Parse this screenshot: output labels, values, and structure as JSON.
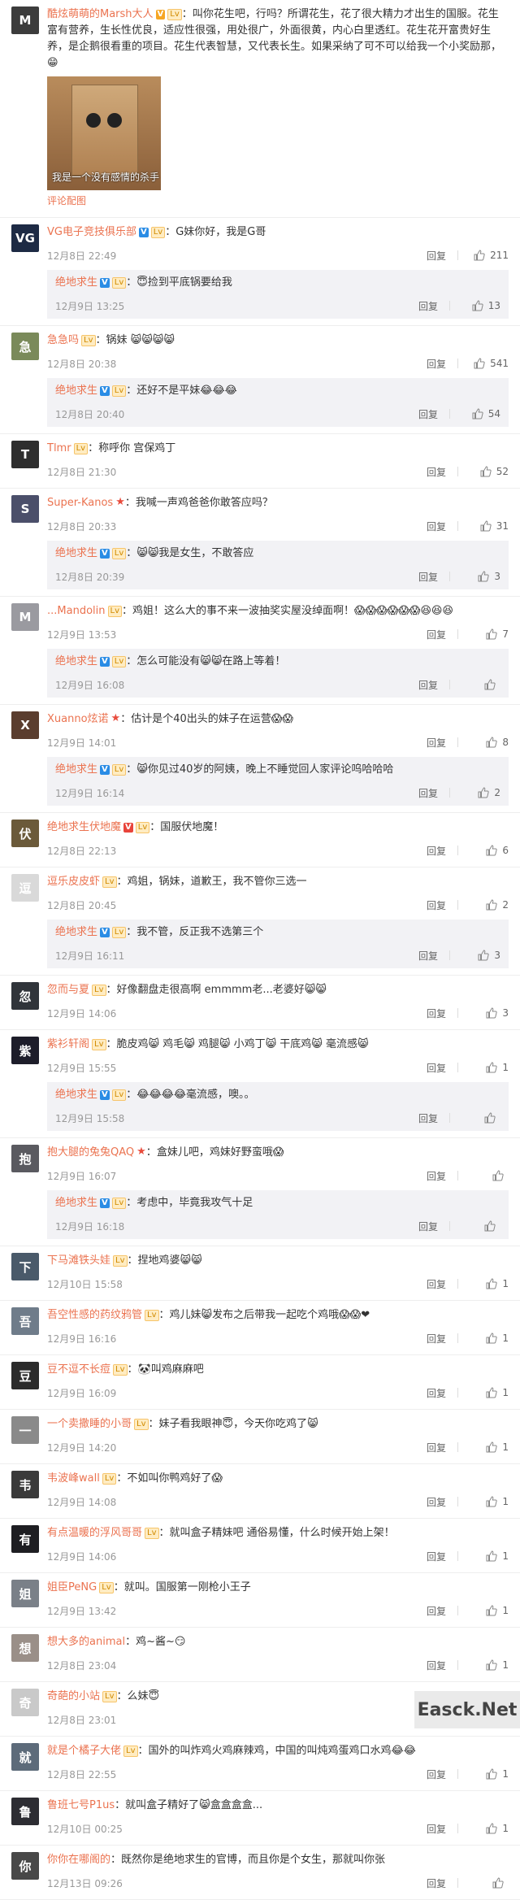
{
  "ui": {
    "reply_label": "回复",
    "view_pic_label": "评论配图"
  },
  "comments": [
    {
      "user": "酷炫萌萌的Marsh大人",
      "badges": [
        "v",
        "lv"
      ],
      "text": "叫你花生吧，行吗？所谓花生，花了很大精力才出生的国服。花生富有营养，生长性优良，适应性很强，用处很广，外面很黄，内心白里透红。花生花开富贵好生养，是企鹅很看重的项目。花生代表智慧，又代表长生。如果采纳了可不可以给我一个小奖励那，😁",
      "has_photo": true,
      "photo_caption": "我是一个没有感情的杀手",
      "avatar_color": "#3c3c3c",
      "avatar_initial": "M"
    },
    {
      "user": "VG电子竞技俱乐部",
      "badges": [
        "vb",
        "lv"
      ],
      "text": "G妹你好，我是G哥",
      "date": "12月8日 22:49",
      "likes": "211",
      "avatar_color": "#1d2a44",
      "avatar_initial": "VG",
      "sub": {
        "user": "绝地求生",
        "badges": [
          "vb",
          "lv"
        ],
        "text": "😇捡到平底锅要给我",
        "date": "12月9日 13:25",
        "likes": "13"
      }
    },
    {
      "user": "急急吗",
      "badges": [
        "lv"
      ],
      "text": "锅妹 😸😸😸😸",
      "date": "12月8日 20:38",
      "likes": "541",
      "avatar_color": "#7a8a5a",
      "avatar_initial": "急",
      "sub": {
        "user": "绝地求生",
        "badges": [
          "vb",
          "lv"
        ],
        "text": "还好不是平妹😂😂😂",
        "date": "12月8日 20:40",
        "likes": "54"
      }
    },
    {
      "user": "Tlmr",
      "badges": [
        "lv"
      ],
      "text": "称呼你 宫保鸡丁",
      "date": "12月8日 21:30",
      "likes": "52",
      "avatar_color": "#2e2e2e",
      "avatar_initial": "T"
    },
    {
      "user": "Super-Kanos",
      "badges": [
        "star"
      ],
      "text": "我喊一声鸡爸爸你敢答应吗？",
      "date": "12月8日 20:33",
      "likes": "31",
      "avatar_color": "#4b4f6a",
      "avatar_initial": "S",
      "sub": {
        "user": "绝地求生",
        "badges": [
          "vb",
          "lv"
        ],
        "text": "😸😸我是女生，不敢答应",
        "date": "12月8日 20:39",
        "likes": "3"
      }
    },
    {
      "user": "...Mandolin",
      "badges": [
        "lv"
      ],
      "text": "鸡姐！这么大的事不来一波抽奖实屋没绰面啊！😱😱😱😱😱😱😆😆😆",
      "date": "12月9日 13:53",
      "likes": "7",
      "avatar_color": "#9a9aa0",
      "avatar_initial": "M",
      "sub": {
        "user": "绝地求生",
        "badges": [
          "vb",
          "lv"
        ],
        "text": "怎么可能没有😸😸在路上等着！",
        "date": "12月9日 16:08",
        "likes": ""
      }
    },
    {
      "user": "Xuanno炫诺",
      "badges": [
        "star"
      ],
      "text": "估计是个40出头的妹子在运营😱😱",
      "date": "12月9日 14:01",
      "likes": "8",
      "avatar_color": "#5a3d2e",
      "avatar_initial": "X",
      "sub": {
        "user": "绝地求生",
        "badges": [
          "vb",
          "lv"
        ],
        "text": "😸你见过40岁的阿姨，晚上不睡觉回人家评论呜哈哈哈",
        "date": "12月9日 16:14",
        "likes": "2"
      }
    },
    {
      "user": "绝地求生伏地魔",
      "badges": [
        "vr",
        "lv"
      ],
      "text": "国服伏地魔！",
      "date": "12月8日 22:13",
      "likes": "6",
      "avatar_color": "#6b5a3a",
      "avatar_initial": "伏"
    },
    {
      "user": "逗乐皮皮虾",
      "badges": [
        "lv"
      ],
      "text": "鸡姐，锅妹，道歉王，我不管你三选一",
      "date": "12月8日 20:45",
      "likes": "2",
      "avatar_color": "#d9d9d9",
      "avatar_initial": "逗",
      "sub": {
        "user": "绝地求生",
        "badges": [
          "vb",
          "lv"
        ],
        "text": "我不管，反正我不选第三个",
        "date": "12月9日 16:11",
        "likes": "3"
      }
    },
    {
      "user": "忽而与夏",
      "badges": [
        "lv"
      ],
      "text": "好像翻盘走很高啊 emmmm老...老婆好😸😸",
      "date": "12月9日 14:06",
      "likes": "3",
      "avatar_color": "#30343a",
      "avatar_initial": "忽"
    },
    {
      "user": "紫衫轩阁",
      "badges": [
        "lv"
      ],
      "text": "脆皮鸡😸 鸡毛😸 鸡腿😸 小鸡丁😸 干底鸡😸 毫流感😸",
      "date": "12月9日 15:55",
      "likes": "1",
      "avatar_color": "#1d1d2a",
      "avatar_initial": "紫",
      "sub": {
        "user": "绝地求生",
        "badges": [
          "vb",
          "lv"
        ],
        "text": "😂😂😂😂毫流感，噢。。",
        "date": "12月9日 15:58",
        "likes": ""
      }
    },
    {
      "user": "抱大腿的兔兔QAQ",
      "badges": [
        "star"
      ],
      "text": "盒妹儿吧，鸡妹好野蛮哦😱",
      "date": "12月9日 16:07",
      "likes": "",
      "avatar_color": "#5a5a60",
      "avatar_initial": "抱",
      "sub": {
        "user": "绝地求生",
        "badges": [
          "vb",
          "lv"
        ],
        "text": "考虑中，毕竟我攻气十足",
        "date": "12月9日 16:18",
        "likes": ""
      }
    },
    {
      "user": "下马滩铁头娃",
      "badges": [
        "lv"
      ],
      "text": "捏地鸡婆😸😸",
      "date": "12月10日 15:58",
      "likes": "1",
      "avatar_color": "#4a5a6a",
      "avatar_initial": "下"
    },
    {
      "user": "吾空性感的药纹鸦管",
      "badges": [
        "lv"
      ],
      "text": "鸡儿妹😸发布之后带我一起吃个鸡哦😱😱❤",
      "date": "12月9日 16:16",
      "likes": "1",
      "avatar_color": "#6f7c8a",
      "avatar_initial": "吾"
    },
    {
      "user": "豆不逗不长痘",
      "badges": [
        "lv"
      ],
      "text": "🐼叫鸡麻麻吧",
      "date": "12月9日 16:09",
      "likes": "1",
      "avatar_color": "#2b2b2b",
      "avatar_initial": "豆"
    },
    {
      "user": "一个卖撒睡的小哥",
      "badges": [
        "lv"
      ],
      "text": "妹子看我眼神😇，今天你吃鸡了😸",
      "date": "12月9日 14:20",
      "likes": "1",
      "avatar_color": "#8a8a8a",
      "avatar_initial": "一"
    },
    {
      "user": "韦波峰wall",
      "badges": [
        "lv"
      ],
      "text": "不如叫你鸭鸡好了😱",
      "date": "12月9日 14:08",
      "likes": "1",
      "avatar_color": "#3a3a3a",
      "avatar_initial": "韦"
    },
    {
      "user": "有点温暖的浮风哥哥",
      "badges": [
        "lv"
      ],
      "text": "就叫盒子精妹吧 通俗易懂，什么时候开始上架！",
      "date": "12月9日 14:06",
      "likes": "1",
      "avatar_color": "#1e1e22",
      "avatar_initial": "有"
    },
    {
      "user": "姐臣PeNG",
      "badges": [
        "lv"
      ],
      "text": "就叫。国服第一刚枪小王子",
      "date": "12月9日 13:42",
      "likes": "1",
      "avatar_color": "#7a8088",
      "avatar_initial": "姐"
    },
    {
      "user": "想大多的animal",
      "badges": [],
      "text": "鸡~酱~😏",
      "date": "12月8日 23:04",
      "likes": "1",
      "avatar_color": "#9a8f88",
      "avatar_initial": "想"
    },
    {
      "user": "奇葩的小站",
      "badges": [
        "lv"
      ],
      "text": "么妹😇",
      "date": "12月8日 23:01",
      "likes": "1",
      "avatar_color": "#c9c9c9",
      "avatar_initial": "奇"
    },
    {
      "user": "就是个橘子大佬",
      "badges": [
        "lv"
      ],
      "text": "国外的叫炸鸡火鸡麻辣鸡，中国的叫炖鸡蛋鸡口水鸡😂😂",
      "date": "12月8日 22:55",
      "likes": "1",
      "avatar_color": "#5d6b7a",
      "avatar_initial": "就"
    },
    {
      "user": "鲁班七号P1us",
      "badges": [],
      "text": "就叫盒子精好了😸盒盒盒盒...",
      "date": "12月10日 00:25",
      "likes": "1",
      "avatar_color": "#2d2d33",
      "avatar_initial": "鲁"
    },
    {
      "user": "你你在哪阁的",
      "badges": [],
      "text": "既然你是绝地求生的官博，而且你是个女生，那就叫你张",
      "date": "12月13日 09:26",
      "likes": "",
      "avatar_color": "#484848",
      "avatar_initial": "你"
    }
  ],
  "watermark": "Easck.Net"
}
